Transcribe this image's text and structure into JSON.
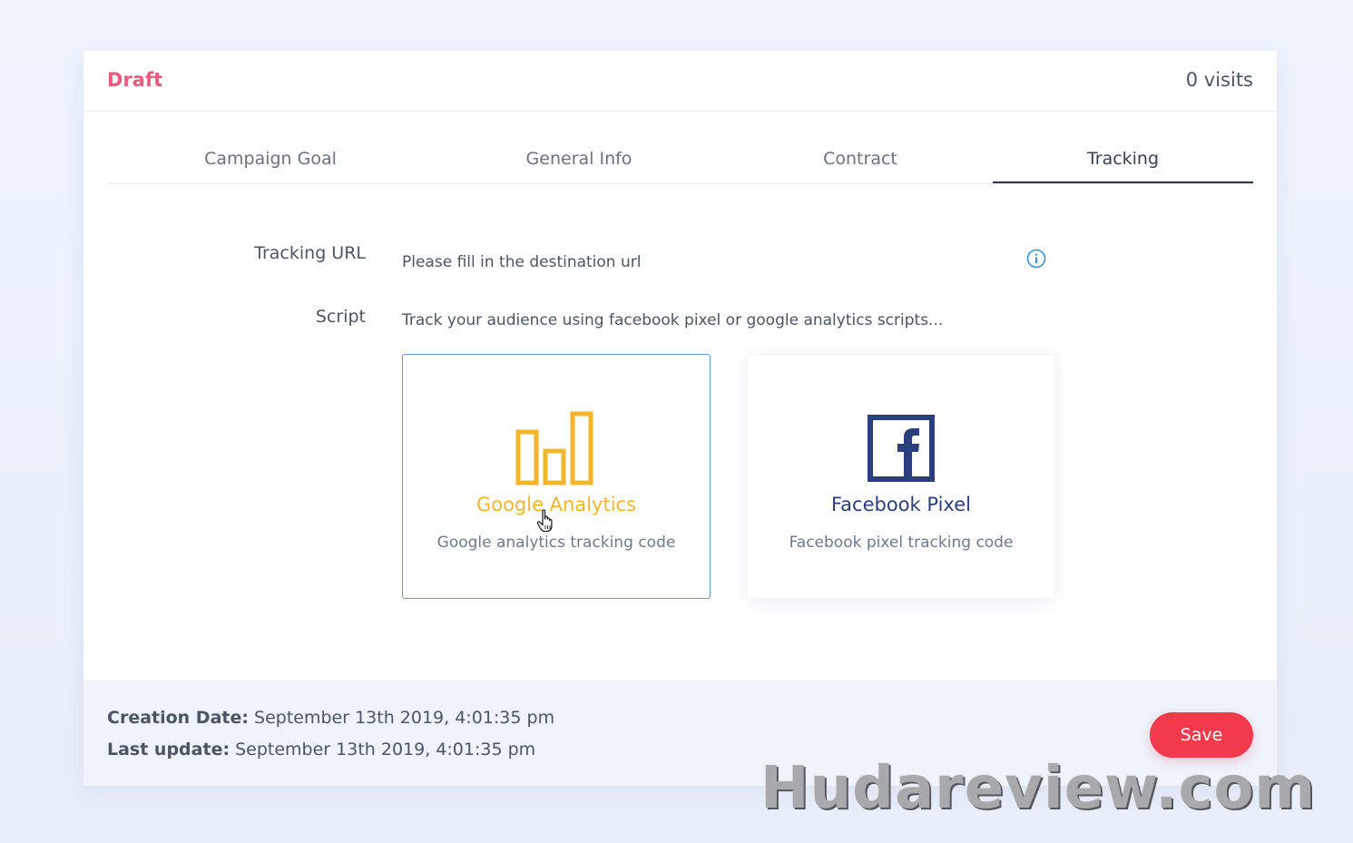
{
  "header": {
    "status": "Draft",
    "visits": "0 visits"
  },
  "tabs": [
    {
      "label": "Campaign Goal"
    },
    {
      "label": "General Info"
    },
    {
      "label": "Contract"
    },
    {
      "label": "Tracking",
      "active": true
    }
  ],
  "tracking": {
    "url_label": "Tracking URL",
    "url_placeholder": "Please fill in the destination url",
    "script_label": "Script",
    "script_description": "Track your audience using facebook pixel or google analytics scripts..."
  },
  "options": [
    {
      "title": "Google Analytics",
      "subtitle": "Google analytics tracking code",
      "icon": "bar-chart-icon",
      "color": "#f3b52a",
      "selected": true
    },
    {
      "title": "Facebook Pixel",
      "subtitle": "Facebook pixel tracking code",
      "icon": "facebook-icon",
      "color": "#2b3f7a",
      "selected": false
    }
  ],
  "footer": {
    "creation_label": "Creation Date:",
    "creation_value": " September 13th 2019, 4:01:35 pm",
    "update_label": "Last update:",
    "update_value": " September 13th 2019, 4:01:35 pm",
    "save_label": "Save"
  },
  "watermark": "Hudareview.com",
  "colors": {
    "status": "#ea5b7c",
    "save": "#f23a4c",
    "selected_border": "#6e97d6",
    "info": "#3d8fd6"
  }
}
